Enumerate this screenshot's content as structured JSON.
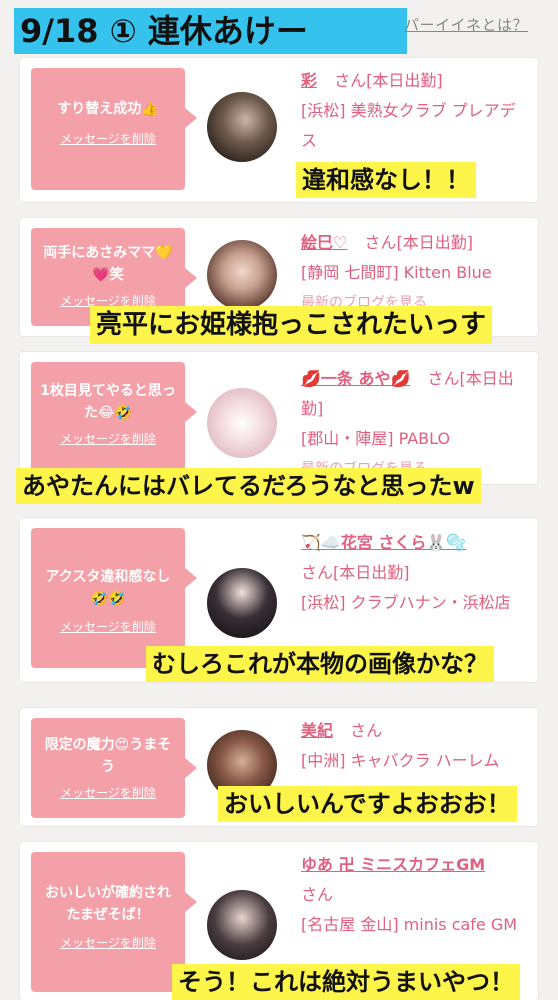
{
  "header": {
    "title": "9/18 ① 連休あけー",
    "link": "パーイイネとは？"
  },
  "cards": [
    {
      "message": "すり替え成功👍",
      "delete_label": "メッセージを削除",
      "name": "彩",
      "honorific": "さん",
      "status": "[本日出勤]",
      "store": "[浜松] 美熟女クラブ プレアデス",
      "extra": "",
      "caption": "違和感なし！！"
    },
    {
      "message": "両手にあさみママ💛💗笑",
      "delete_label": "メッセージを削除",
      "name": "絵巳♡",
      "honorific": "さん",
      "status": "[本日出勤]",
      "store": "[静岡 七間町] Kitten Blue",
      "extra": "最新のブログを見る",
      "caption": "亮平にお姫様抱っこされたいっす"
    },
    {
      "message": "1枚目見てやると思った😂🤣",
      "delete_label": "メッセージを削除",
      "name": "💋一条 あや💋",
      "honorific": "さん",
      "status": "[本日出勤]",
      "store": "[郡山・陣屋] PABLO",
      "extra": "最新のブログを見る",
      "caption": "あやたんにはバレてるだろうなと思ったw"
    },
    {
      "message": "アクスタ違和感なし🤣🤣",
      "delete_label": "メッセージを削除",
      "name": "🏹☁️花宮 さくら🐰🫧",
      "honorific": "さん",
      "status": "[本日出勤]",
      "store": "[浜松] クラブハナン・浜松店",
      "extra": "",
      "caption": "むしろこれが本物の画像かな？"
    },
    {
      "message": "限定の魔力😍うまそう",
      "delete_label": "メッセージを削除",
      "name": "美紀",
      "honorific": "さん",
      "status": "",
      "store": "[中洲] キャバクラ ハーレム",
      "extra": "",
      "caption": "おいしいんですよおおお！"
    },
    {
      "message": "おいしいが確約されたまぜそば！",
      "delete_label": "メッセージを削除",
      "name": "ゆあ 卍 ミニスカフェGM",
      "honorific": "さん",
      "status": "",
      "store": "[名古屋 金山] minis cafe GM",
      "extra": "",
      "caption": "そう！これは絶対うまいやつ！"
    }
  ]
}
